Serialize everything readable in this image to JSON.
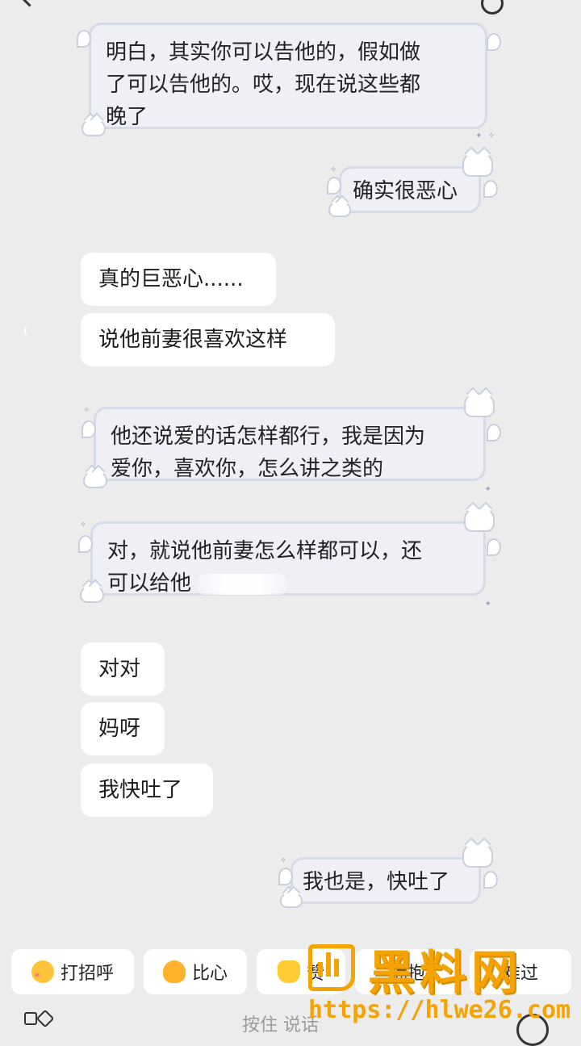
{
  "messages": {
    "m1": "明白，其实你可以告他的，假如做了可以告他的。哎，现在说这些都晚了",
    "m1_l1": "明白，其实你可以告他的，假如做",
    "m1_l2": "了可以告他的。哎，现在说这些都",
    "m1_l3": "晚了",
    "m2": "确实很恶心",
    "m3": "真的巨恶心......",
    "m4": "说他前妻很喜欢这样",
    "m5_l1": "他还说爱的话怎样都行，我是因为",
    "m5_l2": "爱你，喜欢你，怎么讲之类的",
    "m6_l1": "对，就说他前妻怎么样都可以，还",
    "m6_l2": "可以给他",
    "m7": "对对",
    "m8": "妈呀",
    "m9": "我快吐了",
    "m10": "我也是，快吐了"
  },
  "quick_replies": {
    "greet": "打招呼",
    "heart": "比心",
    "thumb": "赞",
    "hug": "拥抱",
    "sad": "难过"
  },
  "input": {
    "placeholder": "按住 说话"
  },
  "watermark": {
    "brand": "黑料网",
    "url": "https://hlwe26.com"
  },
  "colors": {
    "background": "#ececec",
    "bubble_plain": "#ffffff",
    "bubble_cloud": "#eef0f6",
    "watermark": "#f5a300"
  }
}
